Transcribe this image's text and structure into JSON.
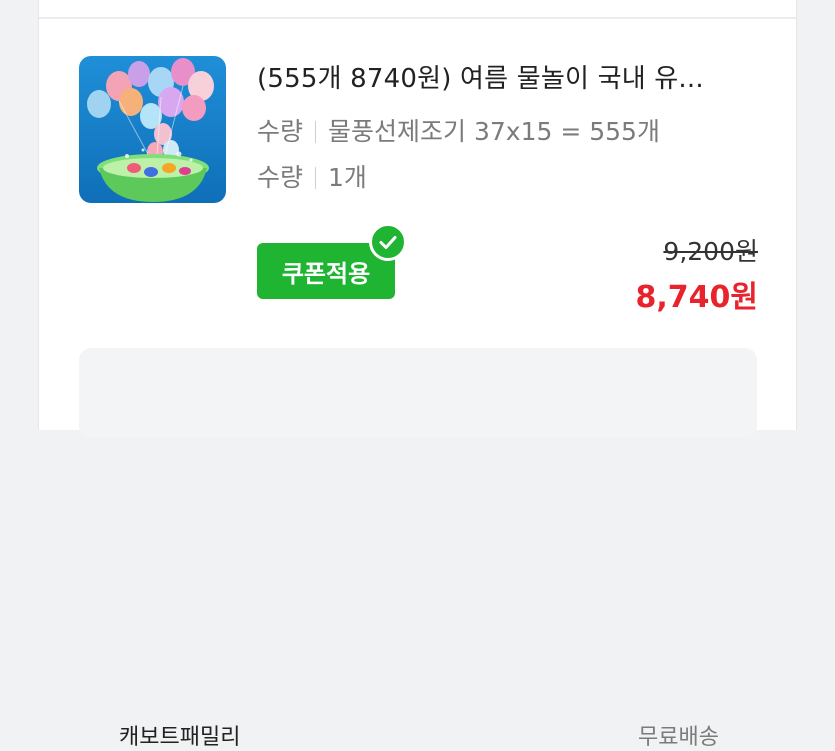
{
  "product": {
    "title": "(555개 8740원) 여름 물놀이 국내 유...",
    "options": [
      {
        "label": "수량",
        "value": "물풍선제조기 37x15 = 555개"
      },
      {
        "label": "수량",
        "value": "1개"
      }
    ],
    "coupon_label": "쿠폰적용",
    "original_price": "9,200원",
    "sale_price": "8,740원",
    "thumbnail_icon": "water-balloon-product-image"
  },
  "shipping": {
    "seller": "캐보트패밀리",
    "fee": "무료배송"
  },
  "colors": {
    "coupon_green": "#1fb431",
    "price_red": "#e8232c"
  }
}
